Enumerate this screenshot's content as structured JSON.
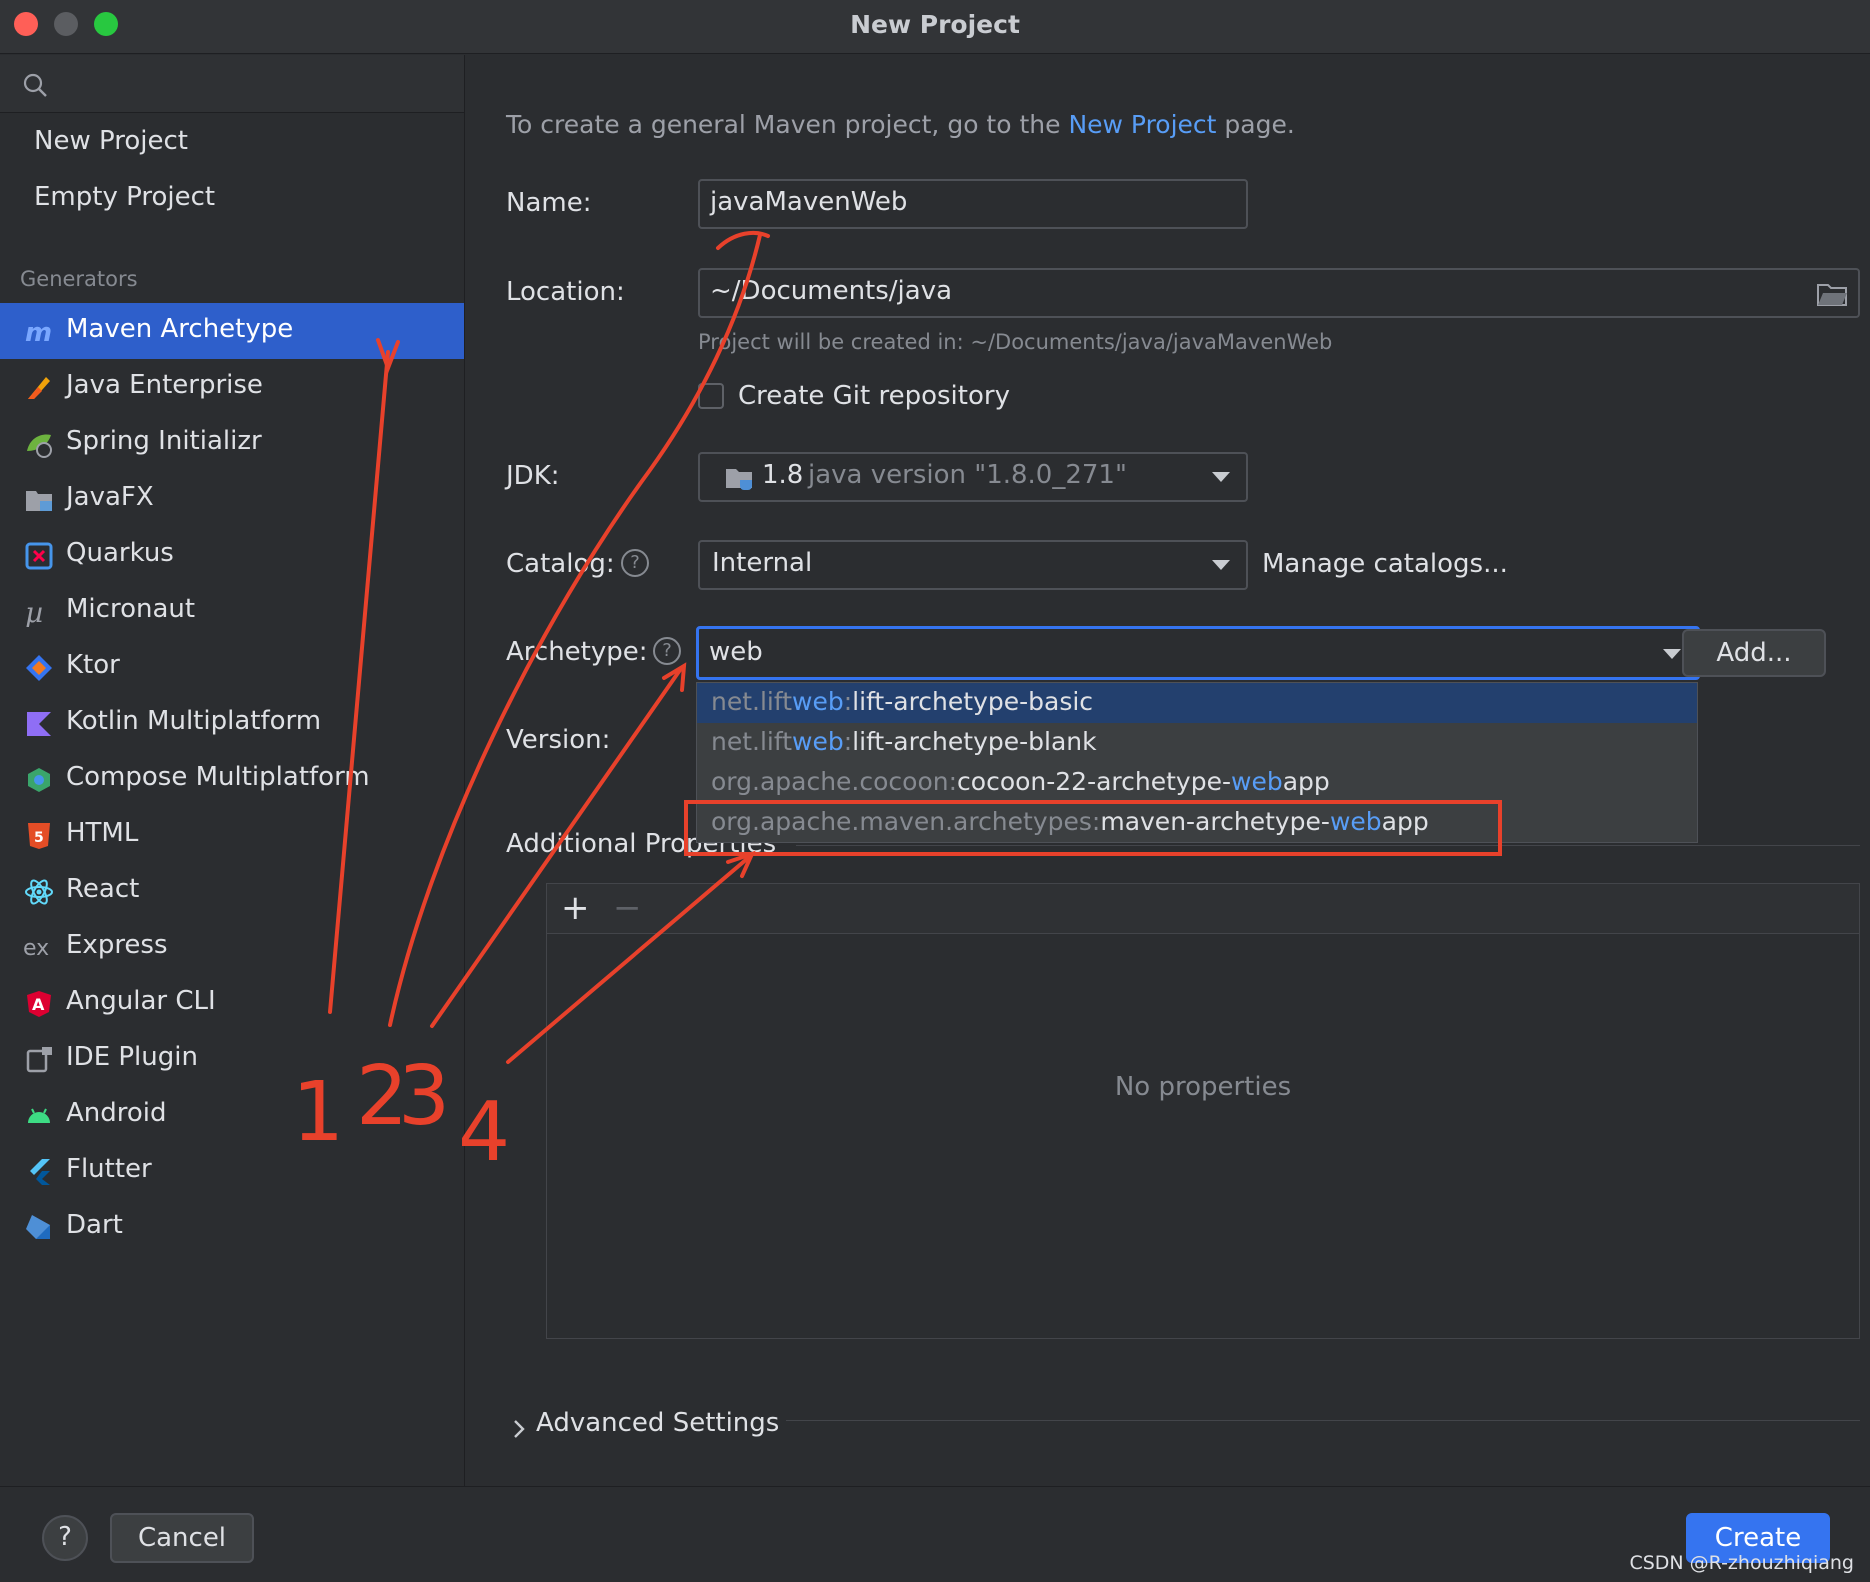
{
  "window": {
    "title": "New Project"
  },
  "sidebar": {
    "search_placeholder": "",
    "top_items": [
      {
        "label": "New Project"
      },
      {
        "label": "Empty Project"
      }
    ],
    "generators_label": "Generators",
    "generators": [
      {
        "label": "Maven Archetype",
        "icon": "maven-icon",
        "selected": true
      },
      {
        "label": "Java Enterprise",
        "icon": "java-enterprise-icon"
      },
      {
        "label": "Spring Initializr",
        "icon": "spring-icon"
      },
      {
        "label": "JavaFX",
        "icon": "javafx-icon"
      },
      {
        "label": "Quarkus",
        "icon": "quarkus-icon"
      },
      {
        "label": "Micronaut",
        "icon": "micronaut-icon"
      },
      {
        "label": "Ktor",
        "icon": "ktor-icon"
      },
      {
        "label": "Kotlin Multiplatform",
        "icon": "kotlin-icon"
      },
      {
        "label": "Compose Multiplatform",
        "icon": "compose-icon"
      },
      {
        "label": "HTML",
        "icon": "html5-icon"
      },
      {
        "label": "React",
        "icon": "react-icon"
      },
      {
        "label": "Express",
        "icon": "express-icon"
      },
      {
        "label": "Angular CLI",
        "icon": "angular-icon"
      },
      {
        "label": "IDE Plugin",
        "icon": "ide-plugin-icon"
      },
      {
        "label": "Android",
        "icon": "android-icon"
      },
      {
        "label": "Flutter",
        "icon": "flutter-icon"
      },
      {
        "label": "Dart",
        "icon": "dart-icon"
      }
    ]
  },
  "main": {
    "hint_prefix": "To create a general Maven project, go to the ",
    "hint_link": "New Project",
    "hint_suffix": " page.",
    "name_label": "Name:",
    "name_value": "javaMavenWeb",
    "location_label": "Location:",
    "location_value": "~/Documents/java",
    "location_hint": "Project will be created in: ~/Documents/java/javaMavenWeb",
    "git_label": "Create Git repository",
    "git_checked": false,
    "jdk_label": "JDK:",
    "jdk_version": "1.8",
    "jdk_detail": "java version \"1.8.0_271\"",
    "catalog_label": "Catalog:",
    "catalog_value": "Internal",
    "manage_catalogs": "Manage catalogs...",
    "archetype_label": "Archetype:",
    "archetype_value": "web",
    "add_button": "Add...",
    "version_label": "Version:",
    "archetype_options": [
      {
        "group_a": "net.lift",
        "group_hit": "web",
        "group_b": ":",
        "artifact_a": "lift-archetype-basic",
        "artifact_hit": "",
        "artifact_b": "",
        "selected": true
      },
      {
        "group_a": "net.lift",
        "group_hit": "web",
        "group_b": ":",
        "artifact_a": "lift-archetype-blank",
        "artifact_hit": "",
        "artifact_b": ""
      },
      {
        "group_a": "org.apache.cocoon:",
        "group_hit": "",
        "group_b": "",
        "artifact_a": "cocoon-22-archetype-",
        "artifact_hit": "web",
        "artifact_b": "app"
      },
      {
        "group_a": "org.apache.maven.archetypes:",
        "group_hit": "",
        "group_b": "",
        "artifact_a": "maven-archetype-",
        "artifact_hit": "web",
        "artifact_b": "app"
      }
    ],
    "additional_properties_label": "Additional Properties",
    "add_property": "+",
    "remove_property": "−",
    "no_properties": "No properties",
    "advanced_settings": "Advanced Settings"
  },
  "footer": {
    "help": "?",
    "cancel": "Cancel",
    "create": "Create"
  },
  "annotations": {
    "numbers": [
      "1",
      "2",
      "3",
      "4"
    ],
    "color": "#e8412b"
  },
  "watermark": "CSDN @R-zhouzhiqiang",
  "colors": {
    "accent": "#3574f0",
    "link": "#589df6",
    "selection": "#2e5fcb",
    "popup_selection": "#23406e"
  }
}
